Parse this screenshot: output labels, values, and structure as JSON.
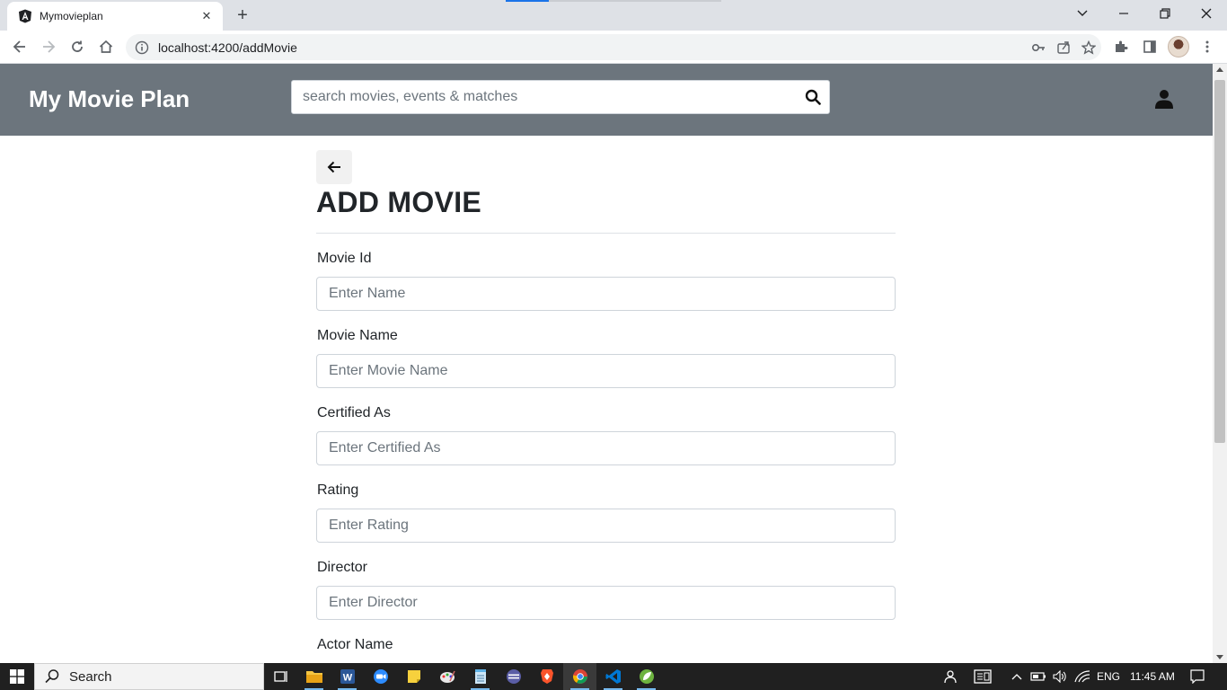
{
  "browser": {
    "tab_title": "Mymovieplan",
    "url": "localhost:4200/addMovie"
  },
  "navbar": {
    "brand": "My Movie Plan",
    "search_placeholder": "search movies, events & matches"
  },
  "form": {
    "title": "ADD MOVIE",
    "fields": [
      {
        "label": "Movie Id",
        "placeholder": "Enter Name"
      },
      {
        "label": "Movie Name",
        "placeholder": "Enter Movie Name"
      },
      {
        "label": "Certified As",
        "placeholder": "Enter Certified As"
      },
      {
        "label": "Rating",
        "placeholder": "Enter Rating"
      },
      {
        "label": "Director",
        "placeholder": "Enter Director"
      },
      {
        "label": "Actor Name",
        "placeholder": ""
      }
    ]
  },
  "taskbar": {
    "search_label": "Search",
    "language": "ENG",
    "time": "11:45 AM",
    "apps": [
      "task-view",
      "file-explorer",
      "word",
      "zoom",
      "sticky-notes",
      "paint",
      "notepad",
      "terminal",
      "brave",
      "chrome",
      "vscode",
      "spring-tool"
    ]
  },
  "colors": {
    "navbar_bg": "#6c757d",
    "tabstrip_bg": "#dee1e6",
    "taskbar_bg": "#202020"
  }
}
